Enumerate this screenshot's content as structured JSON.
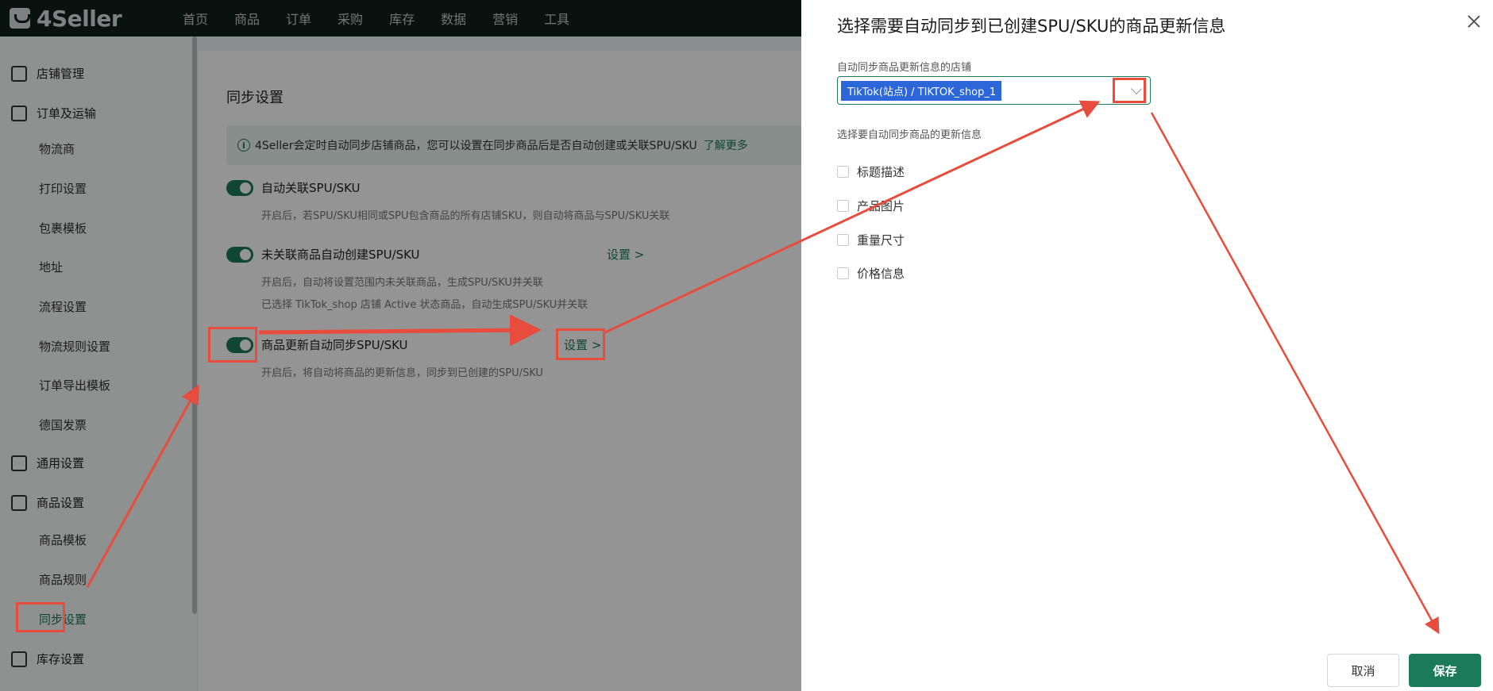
{
  "app": {
    "logo_text": "4Seller"
  },
  "topnav": [
    "首页",
    "商品",
    "订单",
    "采购",
    "库存",
    "数据",
    "营销",
    "工具"
  ],
  "sidebar": {
    "groups": [
      {
        "label": "店铺管理",
        "icon": "store-icon"
      },
      {
        "label": "订单及运输",
        "icon": "clipboard-icon",
        "items": [
          "物流商",
          "打印设置",
          "包裹模板",
          "地址",
          "流程设置",
          "物流规则设置",
          "订单导出模板",
          "德国发票"
        ]
      },
      {
        "label": "通用设置",
        "icon": "printer-icon"
      },
      {
        "label": "商品设置",
        "icon": "upload-box-icon",
        "items": [
          "商品模板",
          "商品规则",
          "同步设置"
        ]
      },
      {
        "label": "库存设置",
        "icon": "inventory-icon"
      }
    ],
    "active_item": "同步设置"
  },
  "main": {
    "title": "同步设置",
    "notice": {
      "text": "4Seller会定时自动同步店铺商品，您可以设置在同步商品后是否自动创建或关联SPU/SKU",
      "link": "了解更多"
    },
    "options": [
      {
        "label": "自动关联SPU/SKU",
        "enabled": true,
        "desc": [
          "开启后，若SPU/SKU相同或SPU包含商品的所有店铺SKU，则自动将商品与SPU/SKU关联"
        ]
      },
      {
        "label": "未关联商品自动创建SPU/SKU",
        "enabled": true,
        "link": "设置 >",
        "desc": [
          "开启后，自动将设置范围内未关联商品，生成SPU/SKU并关联",
          "已选择 TikTok_shop 店铺 Active 状态商品，自动生成SPU/SKU并关联"
        ]
      },
      {
        "label": "商品更新自动同步SPU/SKU",
        "enabled": true,
        "link": "设置 >",
        "desc": [
          "开启后，将自动将商品的更新信息，同步到已创建的SPU/SKU"
        ]
      }
    ]
  },
  "drawer": {
    "title": "选择需要自动同步到已创建SPU/SKU的商品更新信息",
    "store_label": "自动同步商品更新信息的店铺",
    "store_value": "TikTok(站点) / TIKTOK_shop_1",
    "info_label": "选择要自动同步商品的更新信息",
    "checkboxes": [
      {
        "label": "标题描述",
        "checked": false
      },
      {
        "label": "产品图片",
        "checked": false
      },
      {
        "label": "重量尺寸",
        "checked": false
      },
      {
        "label": "价格信息",
        "checked": false
      }
    ],
    "cancel_label": "取消",
    "save_label": "保存"
  },
  "colors": {
    "accent": "#1b7a5a",
    "annotation": "#e74c3c",
    "selection": "#2c66d9"
  }
}
